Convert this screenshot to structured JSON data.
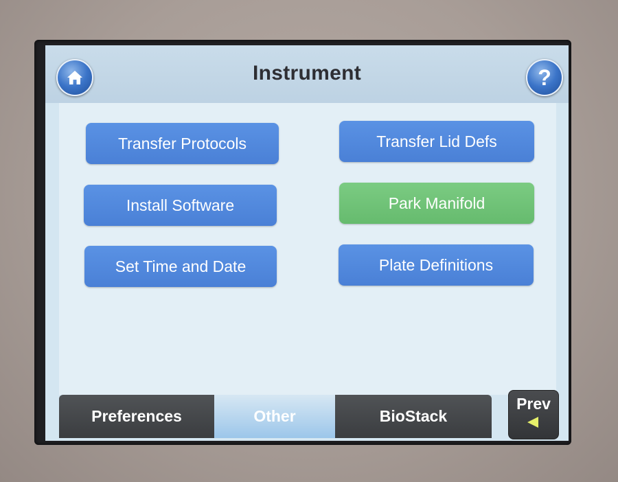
{
  "header": {
    "title": "Instrument"
  },
  "icons": {
    "home": "home-icon",
    "help": "question-mark-icon",
    "prev_arrow": "left-triangle-arrow-icon"
  },
  "help_glyph": "?",
  "menu": {
    "buttons": [
      {
        "label": "Transfer Protocols",
        "color": "#4a80d6"
      },
      {
        "label": "Transfer Lid Defs",
        "color": "#4a80d6"
      },
      {
        "label": "Install Software",
        "color": "#4a80d6"
      },
      {
        "label": "Park Manifold",
        "color": "#66bb6e"
      },
      {
        "label": "Set Time and Date",
        "color": "#4a80d6"
      },
      {
        "label": "Plate Definitions",
        "color": "#4a80d6"
      }
    ]
  },
  "tabs": [
    {
      "label": "Preferences",
      "active": false
    },
    {
      "label": "Other",
      "active": true
    },
    {
      "label": "BioStack",
      "active": false
    }
  ],
  "nav": {
    "prev_label": "Prev",
    "prev_arrow_color": "#e6f06a"
  },
  "colors": {
    "accent_blue": "#4a80d6",
    "accent_green": "#66bb6e",
    "screen_bg": "#d4e6f1"
  }
}
